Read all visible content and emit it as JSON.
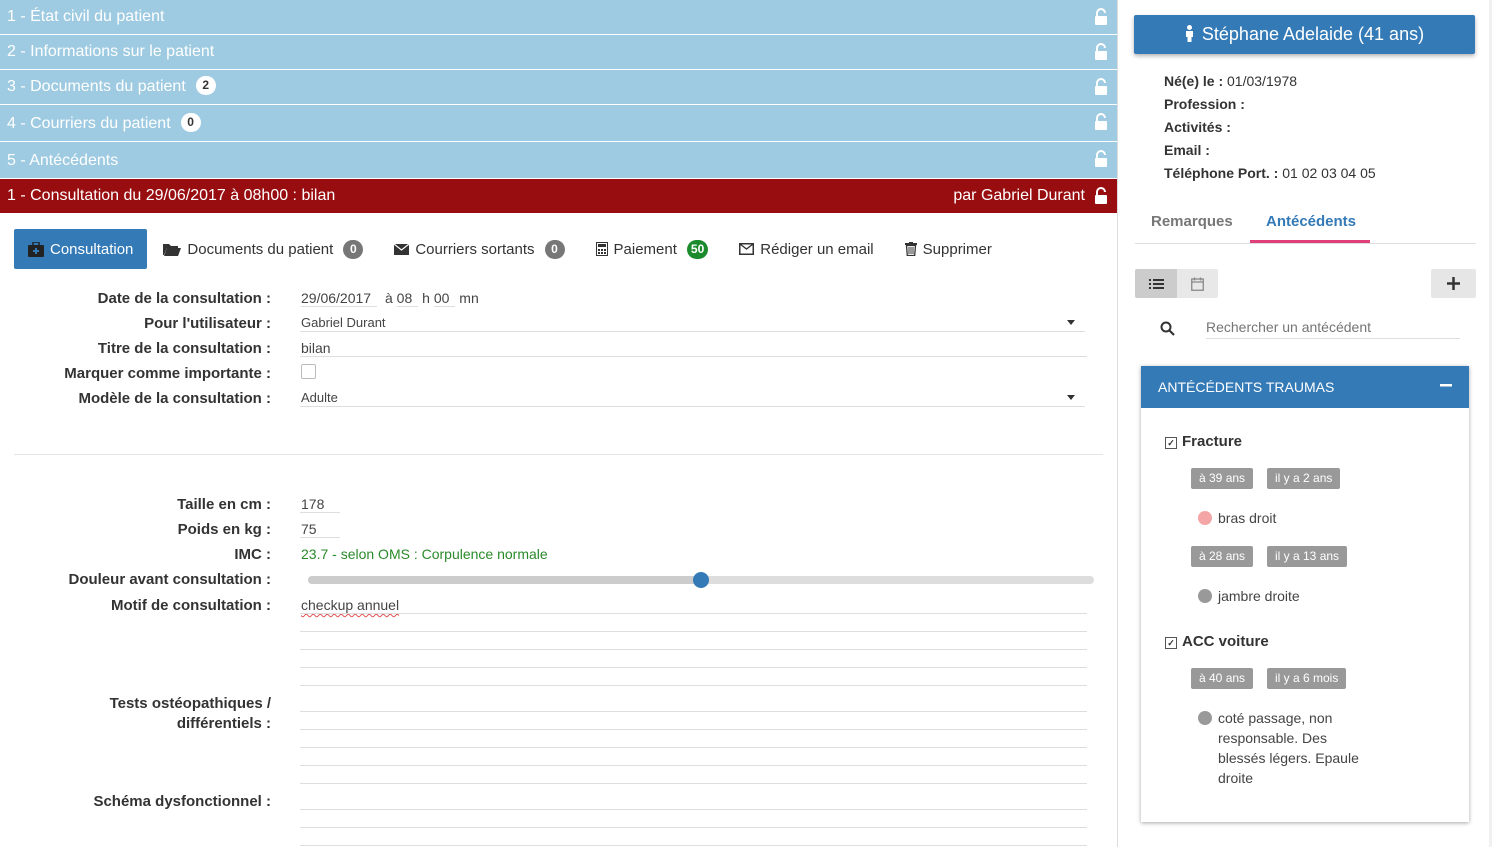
{
  "accordion": [
    {
      "label": "1 - État civil du patient",
      "count": ""
    },
    {
      "label": "2 - Informations sur le patient",
      "count": ""
    },
    {
      "label": "3 - Documents du patient",
      "count": "2"
    },
    {
      "label": "4 - Courriers du patient",
      "count": "0"
    },
    {
      "label": "5 - Antécédents",
      "count": ""
    }
  ],
  "consultation_bar": {
    "title": "1 - Consultation du 29/06/2017 à 08h00 : bilan",
    "by": "par Gabriel Durant"
  },
  "toolbar": {
    "consultation": "Consultation",
    "documents": "Documents du patient",
    "documents_count": "0",
    "courriers": "Courriers sortants",
    "courriers_count": "0",
    "paiement": "Paiement",
    "paiement_count": "50",
    "email": "Rédiger un email",
    "supprimer": "Supprimer"
  },
  "form": {
    "date_label": "Date de la consultation :",
    "date_value": "29/06/2017",
    "at": "à",
    "hour_value": "08",
    "h": "h",
    "min_value": "00",
    "mn": "mn",
    "user_label": "Pour l'utilisateur :",
    "user_value": "Gabriel Durant",
    "title_label": "Titre de la consultation :",
    "title_value": "bilan",
    "important_label": "Marquer comme importante :",
    "model_label": "Modèle de la consultation :",
    "model_value": "Adulte",
    "height_label": "Taille en cm :",
    "height_value": "178",
    "weight_label": "Poids en kg :",
    "weight_value": "75",
    "bmi_label": "IMC :",
    "bmi_value": "23.7 - selon OMS : Corpulence normale",
    "pain_label": "Douleur avant consultation :",
    "pain_level": 0.5,
    "reason_label": "Motif de consultation :",
    "reason_value": "checkup annuel",
    "tests_label_1": "Tests ostéopathiques /",
    "tests_label_2": "différentiels :",
    "schema_label": "Schéma dysfonctionnel :"
  },
  "patient": {
    "name": "Stéphane Adelaide (41 ans)",
    "born_label": "Né(e) le :",
    "born_value": "01/03/1978",
    "profession_label": "Profession :",
    "activites_label": "Activités :",
    "email_label": "Email :",
    "phone_label": "Téléphone Port. :",
    "phone_value": "01 02 03 04 05"
  },
  "right_tabs": {
    "remarques": "Remarques",
    "antecedents": "Antécédents",
    "active": "antecedents"
  },
  "search": {
    "placeholder": "Rechercher un antécédent"
  },
  "trauma_card": {
    "title": "ANTÉCÉDENTS TRAUMAS",
    "items": [
      {
        "title": "Fracture",
        "entries": [
          {
            "age": "à 39 ans",
            "ago": "il y a 2 ans",
            "detail": "bras droit",
            "dot_color": "#f4a6a6"
          },
          {
            "age": "à 28 ans",
            "ago": "il y a 13 ans",
            "detail": "jambre droite",
            "dot_color": "#999999"
          }
        ]
      },
      {
        "title": "ACC voiture",
        "entries": [
          {
            "age": "à 40 ans",
            "ago": "il y a 6 mois",
            "detail_lines": [
              "coté passage, non",
              "responsable. Des",
              "blessés légers. Epaule",
              "droite"
            ],
            "dot_color": "#999999"
          }
        ]
      }
    ]
  },
  "colors": {
    "accordion": "#9ecbe1",
    "consultation_bar": "#980d10",
    "primary": "#337ab7",
    "tab_underline": "#e0407a",
    "bmi_green": "#2a8a2a"
  }
}
